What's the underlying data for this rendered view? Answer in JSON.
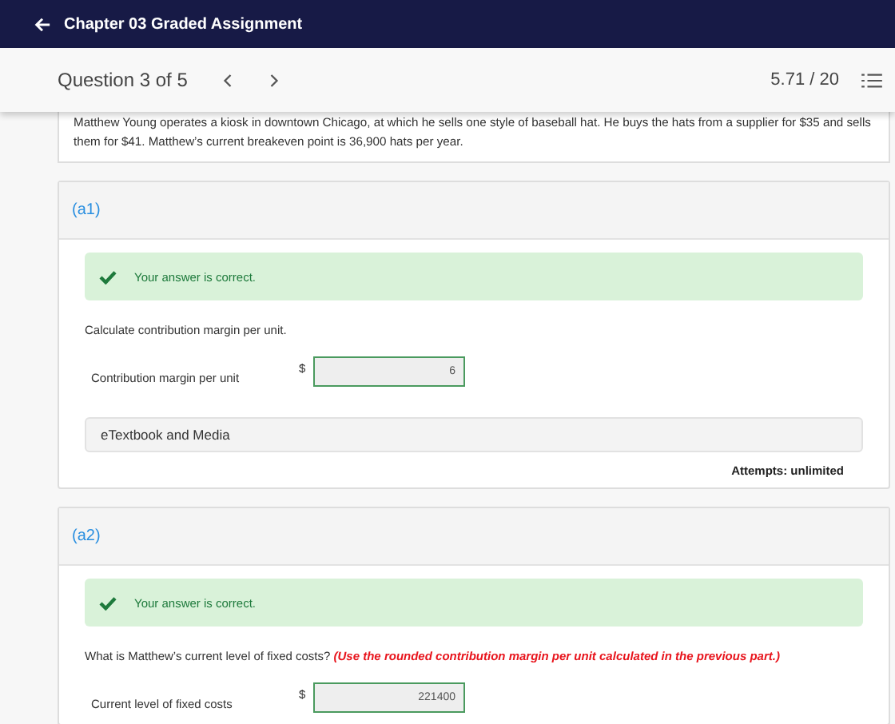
{
  "header": {
    "title": "Chapter 03 Graded Assignment"
  },
  "nav": {
    "question": "Question 3 of 5",
    "score": "5.71 / 20"
  },
  "problem": "Matthew Young operates a kiosk in downtown Chicago, at which he sells one style of baseball hat. He buys the hats from a supplier for $35 and sells them for $41. Matthew’s current breakeven point is 36,900 hats per year.",
  "parts": [
    {
      "label": "(a1)",
      "correct": true,
      "feedback": "Your answer is correct.",
      "question": "Calculate contribution margin per unit.",
      "field_label": "Contribution margin per unit",
      "currency": "$",
      "value": "6",
      "media": "eTextbook and Media",
      "attempts": "Attempts: unlimited"
    },
    {
      "label": "(a2)",
      "correct": true,
      "feedback": "Your answer is correct.",
      "question": "What is Matthew’s current level of fixed costs? *(Use the rounded contribution margin per unit calculated in the previous part.)*",
      "field_label": "Current level of fixed costs",
      "currency": "$",
      "value": "221400"
    }
  ]
}
